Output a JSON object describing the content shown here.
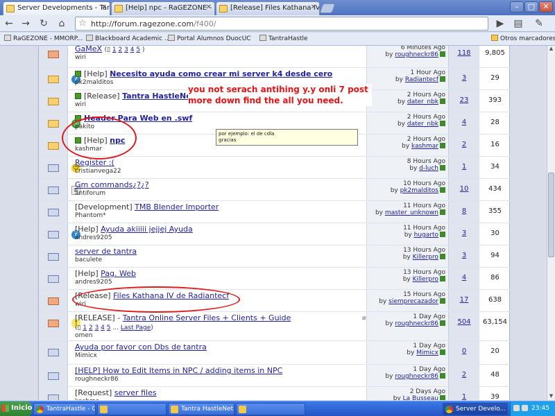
{
  "browser": {
    "tabs": [
      {
        "label": "Server Developments - Tan..."
      },
      {
        "label": "[Help] npc - RaGEZONE - M..."
      },
      {
        "label": "[Release] Files Kathana IV ..."
      }
    ],
    "url_host": "http://forum.ragezone.com",
    "url_path": "/f400/",
    "bookmarks": [
      "RaGEZONE - MMORP...",
      "Blackboard Academic ...",
      "Portal Alumnos DuocUC",
      "TantraHastle"
    ],
    "other_bookmarks": "Otros marcadores"
  },
  "threads": [
    {
      "prefix": "",
      "title": "GaMeX",
      "bold": false,
      "check": false,
      "author": "wiri",
      "pages": [
        "1",
        "2",
        "3",
        "4",
        "5"
      ],
      "last_page": false,
      "time": "6 Minutes Ago",
      "by": "roughneckr86",
      "replies": "118",
      "views": "9,805",
      "icon": "none",
      "status": "hot"
    },
    {
      "prefix": "[Help]",
      "title": "Necesito ayuda como crear mi server k4 desde cero",
      "bold": true,
      "check": true,
      "author": "pk2malditos",
      "pages": [],
      "time": "1 Hour Ago",
      "by": "Radiantecf",
      "replies": "3",
      "views": "29",
      "icon": "q",
      "status": "hot2"
    },
    {
      "prefix": "[Release]",
      "title": "Tantra HastleNetworks",
      "bold": true,
      "check": true,
      "author": "wiri",
      "pages": [],
      "time": "2 Hours Ago",
      "by": "dater_nbk",
      "replies": "23",
      "views": "393",
      "icon": "none",
      "status": "hot2"
    },
    {
      "prefix": "",
      "title": "Header Para Web en .swf",
      "bold": true,
      "check": true,
      "author": "pakito",
      "pages": [],
      "time": "2 Hours Ago",
      "by": "dater_nbk",
      "replies": "4",
      "views": "28",
      "icon": "globe",
      "status": "hot2"
    },
    {
      "prefix": "[Help]",
      "title": "npc",
      "bold": true,
      "check": true,
      "author": "kashmar",
      "pages": [],
      "time": "2 Hours Ago",
      "by": "kashmar",
      "replies": "2",
      "views": "16",
      "icon": "none",
      "status": "hot2"
    },
    {
      "prefix": "",
      "title": "Register :(",
      "bold": false,
      "check": false,
      "author": "cristianvega22",
      "pages": [],
      "time": "8 Hours Ago",
      "by": "d-luch",
      "replies": "1",
      "views": "34",
      "icon": "smile",
      "status": "normal"
    },
    {
      "prefix": "",
      "title": "Gm commands¿?¿?",
      "bold": false,
      "check": false,
      "author": "antiforum",
      "pages": [],
      "time": "10 Hours Ago",
      "by": "pk2malditos",
      "replies": "10",
      "views": "434",
      "icon": "note",
      "status": "normal"
    },
    {
      "prefix": "[Development]",
      "title": "TMB Blender Importer",
      "bold": false,
      "check": false,
      "author": "Phantom*",
      "pages": [],
      "time": "11 Hours Ago",
      "by": "master_unknown",
      "replies": "8",
      "views": "355",
      "icon": "none",
      "status": "normal"
    },
    {
      "prefix": "[Help]",
      "title": "Ayuda akiiiii jejjej Ayuda",
      "bold": false,
      "check": false,
      "author": "andres9205",
      "pages": [],
      "time": "11 Hours Ago",
      "by": "hugarto",
      "replies": "3",
      "views": "30",
      "icon": "q",
      "status": "normal"
    },
    {
      "prefix": "",
      "title": "server de tantra",
      "bold": false,
      "check": false,
      "author": "baculete",
      "pages": [],
      "time": "13 Hours Ago",
      "by": "Killerpro",
      "replies": "3",
      "views": "94",
      "icon": "none",
      "status": "normal"
    },
    {
      "prefix": "[Help]",
      "title": "Pag. Web",
      "bold": false,
      "check": false,
      "author": "andres9205",
      "pages": [],
      "time": "13 Hours Ago",
      "by": "Killerpro",
      "replies": "4",
      "views": "86",
      "icon": "none",
      "status": "normal"
    },
    {
      "prefix": "[Release]",
      "title": "Files Kathana IV de Radiantecf",
      "bold": false,
      "check": false,
      "author": "wiri",
      "pages": [],
      "time": "15 Hours Ago",
      "by": "siempreсazador",
      "replies": "17",
      "views": "638",
      "icon": "none",
      "status": "hot"
    },
    {
      "prefix": "[RELEASE] -",
      "title": "Tantra Online Server Files + Clients + Guide",
      "bold": false,
      "check": false,
      "author": "omen",
      "pages": [
        "1",
        "2",
        "3",
        "4",
        "5"
      ],
      "last_page": true,
      "time": "1 Day Ago",
      "by": "roughneckr86",
      "replies": "504",
      "views": "63,154",
      "icon": "bulb",
      "status": "hot"
    },
    {
      "prefix": "",
      "title": "Ayuda por favor con Dbs de tantra",
      "bold": false,
      "check": false,
      "author": "Mimicx",
      "pages": [],
      "time": "1 Day Ago",
      "by": "Mimicx",
      "replies": "0",
      "views": "20",
      "icon": "none",
      "status": "normal"
    },
    {
      "prefix": "",
      "title": "[HELP] How to Edit Items in NPC / adding items in NPC",
      "bold": false,
      "check": false,
      "author": "roughneckr86",
      "pages": [],
      "time": "1 Day Ago",
      "by": "roughneckr86",
      "replies": "2",
      "views": "48",
      "icon": "none",
      "status": "normal"
    },
    {
      "prefix": "[Request]",
      "title": "server files",
      "bold": false,
      "check": false,
      "author": "kashma",
      "pages": [],
      "time": "2 Days Ago",
      "by": "La Busseau",
      "replies": "1",
      "views": "39",
      "icon": "none",
      "status": "normal"
    }
  ],
  "pages_prefix": "(",
  "pages_suffix": ")",
  "last_page_label": "Last Page",
  "ellipsis": "...",
  "tooltip": {
    "line1": "por ejemplo: el de cdla",
    "line2": "gracias"
  },
  "annotation": "you not serach antihing y.y onli 7 post more down find the all you need.",
  "taskbar": {
    "start": "Inicio",
    "tasks": [
      "TantraHastle - G...",
      "",
      "Tantra HastleNet...",
      "",
      "Server Develo..."
    ],
    "clock": "23:45"
  }
}
